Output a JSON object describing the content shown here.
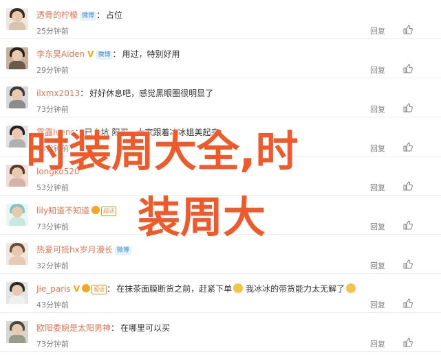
{
  "rows": [
    {
      "user": "透骨的柠檬",
      "badges": [
        "blue"
      ],
      "comment": "占位",
      "time": "25分钟前",
      "reply": "回复",
      "avatar": {
        "hair": "#3a2b20",
        "body": "#d9c4b0",
        "bg": "#efe7de"
      }
    },
    {
      "user": "李东昊Aiden",
      "badges": [
        "v",
        "blue"
      ],
      "comment": "用过，特别好用",
      "time": "29分钟前",
      "reply": "回复",
      "avatar": {
        "hair": "#2b2018",
        "body": "#6e5a4a",
        "bg": "#c7b19a"
      }
    },
    {
      "user": "ilxmx2013",
      "badges": [],
      "comment": "好好休息吧，感觉黑眼圈很明显了",
      "time": "73分钟前",
      "reply": "回复",
      "avatar": {
        "hair": "#3a3a3a",
        "body": "#8c8c8c",
        "bg": "#d8d8d8"
      }
    },
    {
      "user": "露露lvens",
      "badges": [],
      "comment": "已上坑 阳买，大家跟着冰冰姐美起来",
      "time": "33分钟前",
      "reply": "回复",
      "avatar": {
        "hair": "#222",
        "body": "#b0b0b0",
        "bg": "#e2e2e2"
      }
    },
    {
      "user": "longko520",
      "badges": [],
      "comment": "",
      "time": "53分钟前",
      "reply": "回复",
      "avatar": {
        "hair": "#5a3a2a",
        "body": "#d6b3a8",
        "bg": "#f2dcd6"
      }
    },
    {
      "user": "lily知道不知道",
      "badges": [
        "medal",
        "tag"
      ],
      "comment": "",
      "time": "73分钟前",
      "reply": "回复",
      "avatar": {
        "hair": "#7fc7c2",
        "body": "#c8e8e4",
        "bg": "#e9f6f4"
      }
    },
    {
      "user": "热爱可抵hx岁月漫长",
      "badges": [
        "blue"
      ],
      "comment": "",
      "time": "32分钟前",
      "reply": "回复",
      "avatar": {
        "hair": "#6a4a3a",
        "body": "#e7c9b5",
        "bg": "#f3e6dc"
      }
    },
    {
      "user": "Jie_paris",
      "badges": [
        "v",
        "medal",
        "tag"
      ],
      "comment": "在抹茶面膜断货之前，赶紧下单",
      "comment2": "我冰冰的带货能力太无解了",
      "time": "43分钟前",
      "reply": "回复",
      "avatar": {
        "hair": "#2a2a2a",
        "body": "#f0f0f0",
        "bg": "#e4e4e4"
      }
    },
    {
      "user": "欧阳委婉是太阳男神",
      "badges": [],
      "comment": "在哪里可以买",
      "time": "73分钟前",
      "reply": "回复",
      "avatar": {
        "hair": "#4a4a3a",
        "body": "#9a9a8a",
        "bg": "#d6d6cc"
      }
    }
  ],
  "badge_text": {
    "blue": "微博",
    "tag": "超话"
  },
  "overlay": {
    "line1": "时装周大全,时",
    "line2": "装周大"
  },
  "colors": {
    "username": "#eb7350",
    "overlay": "#f05a2a",
    "meta": "#808080"
  }
}
